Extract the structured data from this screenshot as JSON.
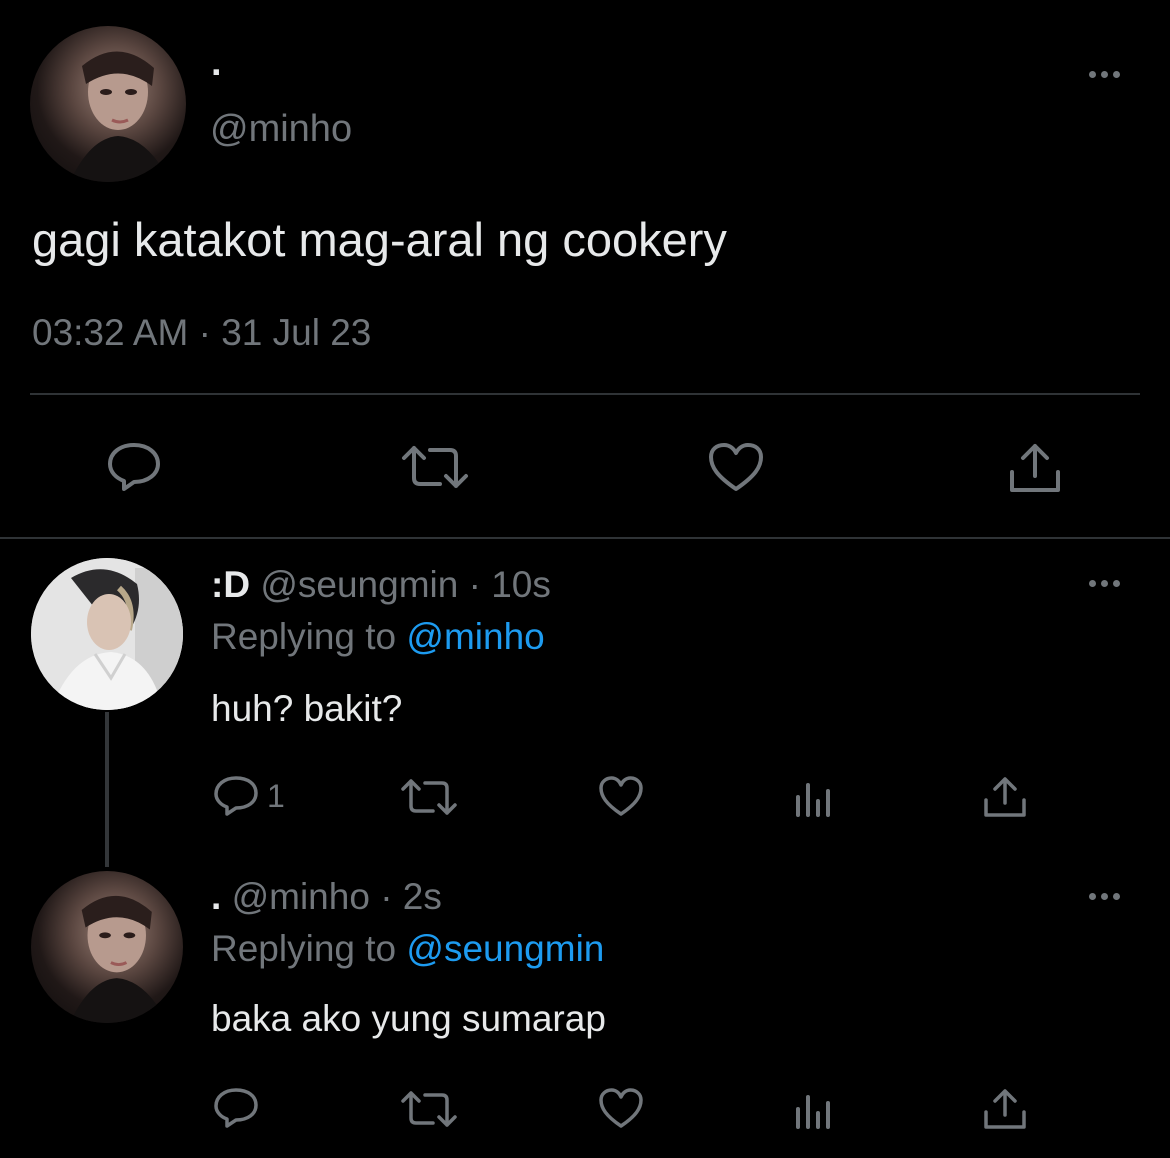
{
  "main_tweet": {
    "display_name": ".",
    "handle": "@minho",
    "text": "gagi katakot mag-aral ng cookery",
    "timestamp": "03:32 AM · 31 Jul 23",
    "actions": [
      "reply-icon",
      "retweet-icon",
      "like-icon",
      "share-icon"
    ]
  },
  "replies": [
    {
      "display_name": ":D",
      "handle": "@seungmin",
      "time": "10s",
      "replying_prefix": "Replying to",
      "replying_to": "@minho",
      "text": "huh? bakit?",
      "reply_count": "1",
      "actions": [
        "reply-icon",
        "retweet-icon",
        "like-icon",
        "analytics-icon",
        "share-icon"
      ]
    },
    {
      "display_name": ".",
      "handle": "@minho",
      "time": "2s",
      "replying_prefix": "Replying to",
      "replying_to": "@seungmin",
      "text": "baka ako yung sumarap",
      "reply_count": "",
      "actions": [
        "reply-icon",
        "retweet-icon",
        "like-icon",
        "analytics-icon",
        "share-icon"
      ]
    }
  ],
  "colors": {
    "background": "#000000",
    "text": "#e7e9ea",
    "muted": "#71767b",
    "link": "#1d9bf0",
    "divider": "#2f3336"
  }
}
